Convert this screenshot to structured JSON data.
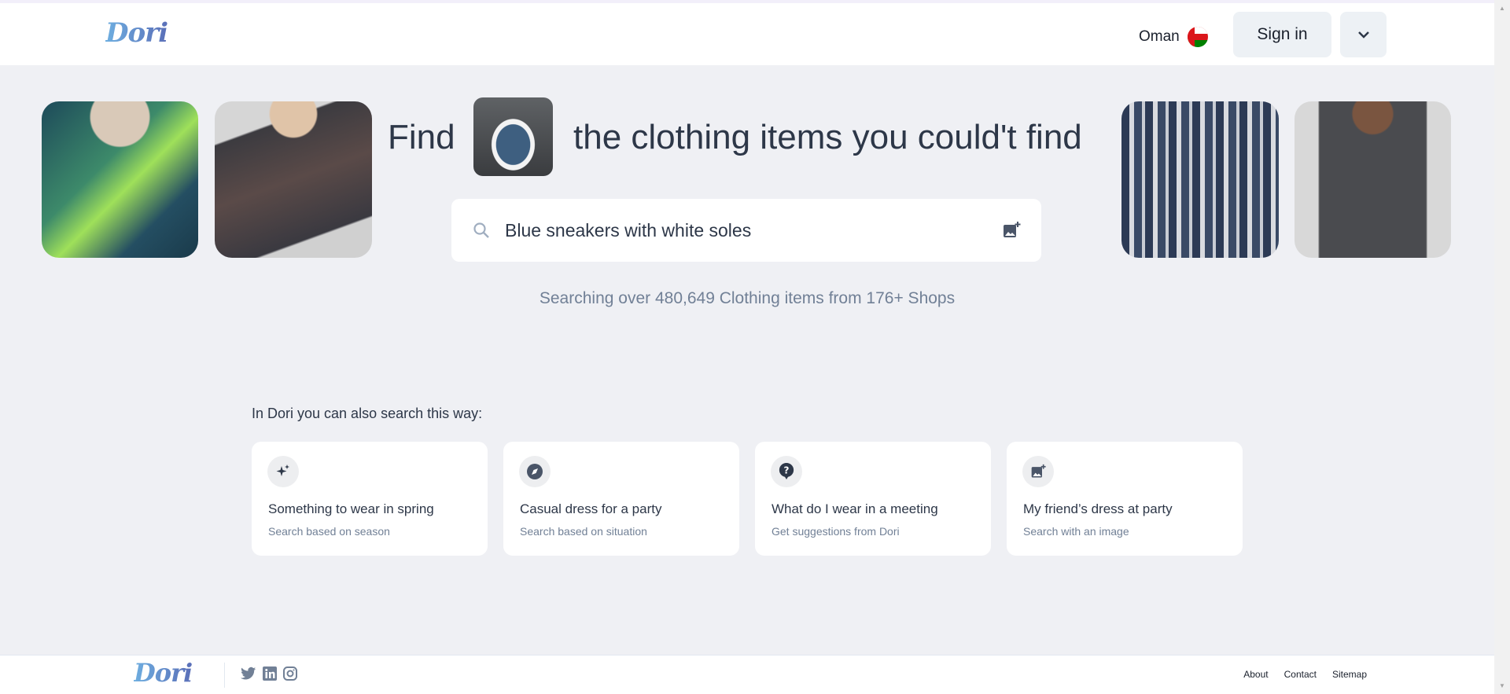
{
  "header": {
    "logo": "Dori",
    "country": "Oman",
    "sign_in": "Sign in",
    "menu_icon": "chevron-down-icon"
  },
  "hero": {
    "find": "Find",
    "headline": "the clothing items you could't find",
    "search_value": "Blue sneakers with white soles",
    "stats": "Searching over 480,649 Clothing items from 176+ Shops"
  },
  "suggestions": {
    "heading": "In Dori you can also search this way:",
    "cards": [
      {
        "title": "Something to wear in spring",
        "subtitle": "Search based on season",
        "icon": "sparkles-icon"
      },
      {
        "title": "Casual dress for a party",
        "subtitle": "Search based on situation",
        "icon": "compass-icon"
      },
      {
        "title": "What do I wear in a meeting",
        "subtitle": "Get suggestions from Dori",
        "icon": "question-bubble-icon"
      },
      {
        "title": "My friend’s dress at party",
        "subtitle": "Search with an image",
        "icon": "add-image-icon"
      }
    ]
  },
  "footer": {
    "logo": "Dori",
    "links": [
      "About",
      "Contact",
      "Sitemap"
    ],
    "social": [
      "twitter",
      "linkedin",
      "instagram"
    ]
  }
}
